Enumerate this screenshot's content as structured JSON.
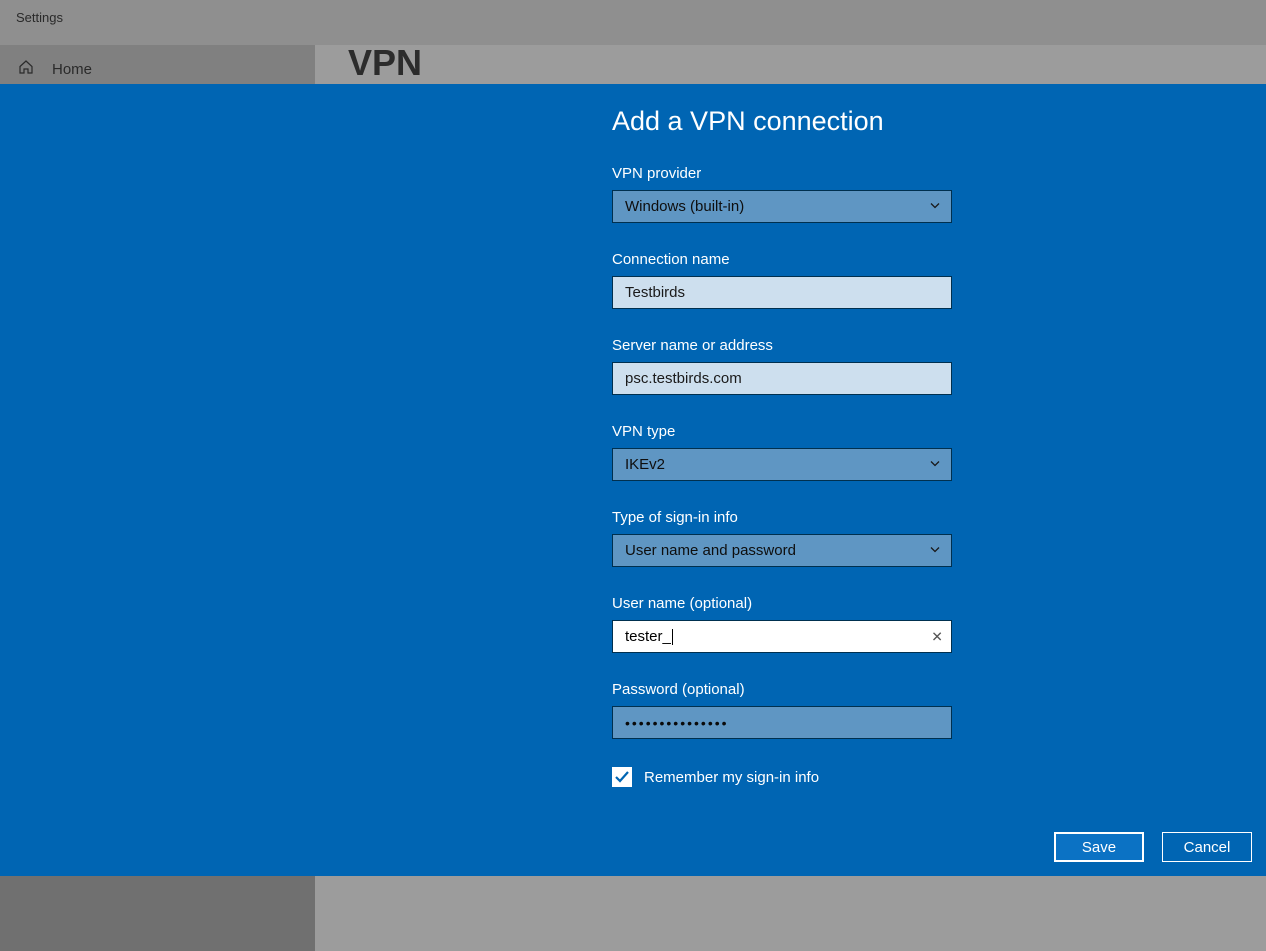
{
  "bg": {
    "window_title": "Settings",
    "home_label": "Home",
    "page_heading": "VPN"
  },
  "dialog": {
    "title": "Add a VPN connection",
    "vpn_provider": {
      "label": "VPN provider",
      "value": "Windows (built-in)"
    },
    "connection_name": {
      "label": "Connection name",
      "value": "Testbirds"
    },
    "server": {
      "label": "Server name or address",
      "value": "psc.testbirds.com"
    },
    "vpn_type": {
      "label": "VPN type",
      "value": "IKEv2"
    },
    "signin_type": {
      "label": "Type of sign-in info",
      "value": "User name and password"
    },
    "username": {
      "label": "User name (optional)",
      "value": "tester_"
    },
    "password": {
      "label": "Password (optional)",
      "masked_value": "•••••••••••••••"
    },
    "remember": {
      "label": "Remember my sign-in info",
      "checked": true
    },
    "buttons": {
      "save": "Save",
      "cancel": "Cancel"
    }
  }
}
